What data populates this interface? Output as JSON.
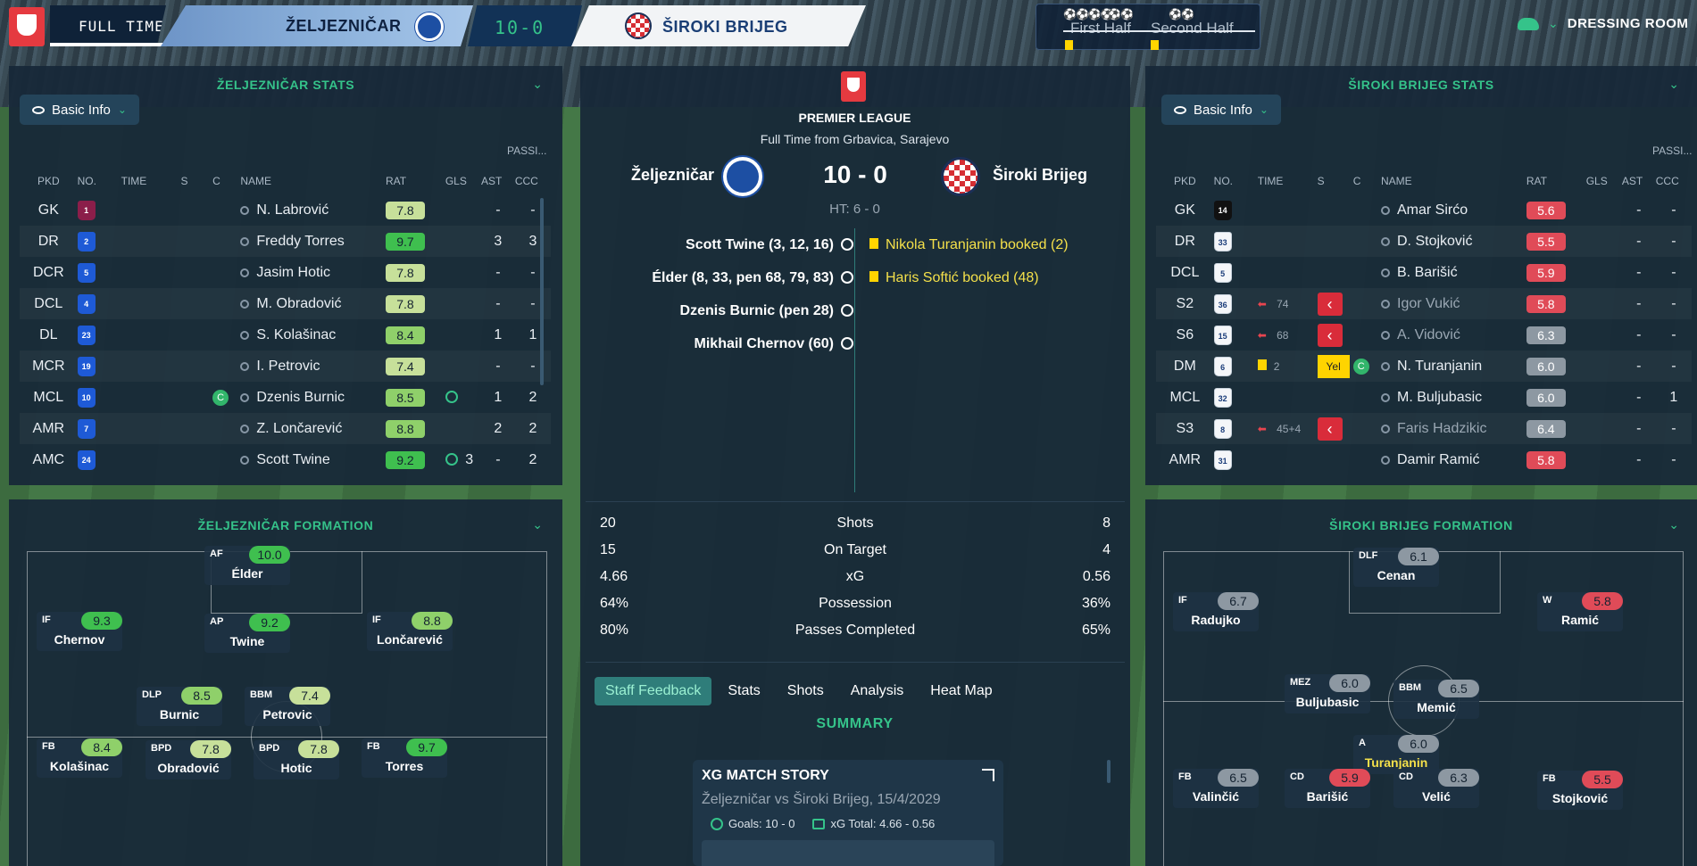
{
  "header": {
    "status": "FULL TIME",
    "home_team": "ŽELJEZNIČAR",
    "score": "10-0",
    "away_team": "ŠIROKI BRIJEG",
    "first_half": "First Half",
    "second_half": "Second Half",
    "home_goal_icons": "⚽⚽⚽⚽",
    "home_goal_icons_2": "⚽⚽",
    "away_goal_icons": "⚽⚽",
    "dressing_room": "DRESSING ROOM"
  },
  "left_stats": {
    "title": "ŽELJEZNIČAR STATS",
    "view": "Basic Info",
    "passing_label": "PASSI...",
    "columns": [
      "PKD",
      "NO.",
      "TIME",
      "S",
      "C",
      "NAME",
      "RAT",
      "GLS",
      "AST",
      "CCC"
    ],
    "rows": [
      {
        "pos": "GK",
        "no": "1",
        "name": "N. Labrović",
        "rat": "7.8",
        "gls": "",
        "ast": "-",
        "ccc": "-"
      },
      {
        "pos": "DR",
        "no": "2",
        "name": "Freddy Torres",
        "rat": "9.7",
        "gls": "",
        "ast": "3",
        "ccc": "3"
      },
      {
        "pos": "DCR",
        "no": "5",
        "name": "Jasim Hotic",
        "rat": "7.8",
        "gls": "",
        "ast": "-",
        "ccc": "-"
      },
      {
        "pos": "DCL",
        "no": "4",
        "name": "M. Obradović",
        "rat": "7.8",
        "gls": "",
        "ast": "-",
        "ccc": "-"
      },
      {
        "pos": "DL",
        "no": "23",
        "name": "S. Kolašinac",
        "rat": "8.4",
        "gls": "",
        "ast": "1",
        "ccc": "1"
      },
      {
        "pos": "MCR",
        "no": "19",
        "name": "I. Petrovic",
        "rat": "7.4",
        "gls": "",
        "ast": "-",
        "ccc": "-"
      },
      {
        "pos": "MCL",
        "no": "10",
        "name": "Dzenis Burnic",
        "rat": "8.5",
        "gls": "",
        "ast": "1",
        "ccc": "2"
      },
      {
        "pos": "AMR",
        "no": "7",
        "name": "Z. Lončarević",
        "rat": "8.8",
        "gls": "",
        "ast": "2",
        "ccc": "2"
      },
      {
        "pos": "AMC",
        "no": "24",
        "name": "Scott Twine",
        "rat": "9.2",
        "gls": "3",
        "ast": "-",
        "ccc": "2"
      }
    ]
  },
  "right_stats": {
    "title": "ŠIROKI BRIJEG STATS",
    "view": "Basic Info",
    "passing_label": "PASSI...",
    "columns": [
      "PKD",
      "NO.",
      "TIME",
      "S",
      "C",
      "NAME",
      "RAT",
      "GLS",
      "AST",
      "CCC"
    ],
    "rows": [
      {
        "pos": "GK",
        "no": "14",
        "time": "",
        "name": "Amar Sirćo",
        "rat": "5.6",
        "ast": "-",
        "ccc": "-"
      },
      {
        "pos": "DR",
        "no": "33",
        "time": "",
        "name": "D. Stojković",
        "rat": "5.5",
        "ast": "-",
        "ccc": "-"
      },
      {
        "pos": "DCL",
        "no": "5",
        "time": "",
        "name": "B. Barišić",
        "rat": "5.9",
        "ast": "-",
        "ccc": "-"
      },
      {
        "pos": "S2",
        "no": "36",
        "time": "74",
        "name": "Igor Vukić",
        "rat": "5.8",
        "ast": "-",
        "ccc": "-"
      },
      {
        "pos": "S6",
        "no": "15",
        "time": "68",
        "name": "A. Vidović",
        "rat": "6.3",
        "ast": "-",
        "ccc": "-"
      },
      {
        "pos": "DM",
        "no": "6",
        "time": "2",
        "name": "N. Turanjanin",
        "rat": "6.0",
        "ast": "-",
        "ccc": "-",
        "card": "Yel"
      },
      {
        "pos": "MCL",
        "no": "32",
        "time": "",
        "name": "M. Buljubasic",
        "rat": "6.0",
        "ast": "-",
        "ccc": "1"
      },
      {
        "pos": "S3",
        "no": "8",
        "time": "45+4",
        "name": "Faris Hadzikic",
        "rat": "6.4",
        "ast": "-",
        "ccc": "-"
      },
      {
        "pos": "AMR",
        "no": "31",
        "time": "",
        "name": "Damir Ramić",
        "rat": "5.8",
        "ast": "-",
        "ccc": "-"
      }
    ]
  },
  "match": {
    "competition": "PREMIER LEAGUE",
    "venue": "Full Time from Grbavica, Sarajevo",
    "home": "Željezničar",
    "away": "Široki Brijeg",
    "score": "10 - 0",
    "ht": "HT: 6 - 0",
    "home_events": [
      "Scott Twine (3, 12, 16)",
      "Élder (8, 33, pen 68, 79, 83)",
      "Dzenis Burnic (pen 28)",
      "Mikhail Chernov (60)"
    ],
    "away_events": [
      "Nikola Turanjanin booked (2)",
      "Haris Softić booked (48)"
    ],
    "stats": [
      {
        "home": "20",
        "label": "Shots",
        "away": "8"
      },
      {
        "home": "15",
        "label": "On Target",
        "away": "4"
      },
      {
        "home": "4.66",
        "label": "xG",
        "away": "0.56"
      },
      {
        "home": "64%",
        "label": "Possession",
        "away": "36%"
      },
      {
        "home": "80%",
        "label": "Passes Completed",
        "away": "65%"
      }
    ],
    "tabs": [
      "Staff Feedback",
      "Stats",
      "Shots",
      "Analysis",
      "Heat Map"
    ],
    "summary": "SUMMARY",
    "xg_card": {
      "title": "XG MATCH STORY",
      "subtitle": "Željezničar vs Široki Brijeg, 15/4/2029",
      "goals": "Goals: 10 - 0",
      "xg_total": "xG Total: 4.66 - 0.56"
    }
  },
  "left_formation": {
    "title": "ŽELJEZNIČAR FORMATION",
    "players": [
      {
        "role": "AF",
        "rating": "10.0",
        "name": "Élder"
      },
      {
        "role": "IF",
        "rating": "9.3",
        "name": "Chernov"
      },
      {
        "role": "AP",
        "rating": "9.2",
        "name": "Twine"
      },
      {
        "role": "IF",
        "rating": "8.8",
        "name": "Lončarević"
      },
      {
        "role": "DLP",
        "rating": "8.5",
        "name": "Burnic"
      },
      {
        "role": "BBM",
        "rating": "7.4",
        "name": "Petrovic"
      },
      {
        "role": "FB",
        "rating": "8.4",
        "name": "Kolašinac"
      },
      {
        "role": "BPD",
        "rating": "7.8",
        "name": "Obradović"
      },
      {
        "role": "BPD",
        "rating": "7.8",
        "name": "Hotic"
      },
      {
        "role": "FB",
        "rating": "9.7",
        "name": "Torres"
      }
    ]
  },
  "right_formation": {
    "title": "ŠIROKI BRIJEG FORMATION",
    "players": [
      {
        "role": "DLF",
        "rating": "6.1",
        "name": "Cenan"
      },
      {
        "role": "IF",
        "rating": "6.7",
        "name": "Radujko"
      },
      {
        "role": "W",
        "rating": "5.8",
        "name": "Ramić"
      },
      {
        "role": "MEZ",
        "rating": "6.0",
        "name": "Buljubasic"
      },
      {
        "role": "BBM",
        "rating": "6.5",
        "name": "Memić"
      },
      {
        "role": "A",
        "rating": "6.0",
        "name": "Turanjanin"
      },
      {
        "role": "FB",
        "rating": "6.5",
        "name": "Valinčić"
      },
      {
        "role": "CD",
        "rating": "5.9",
        "name": "Barišić"
      },
      {
        "role": "CD",
        "rating": "6.3",
        "name": "Velić"
      },
      {
        "role": "FB",
        "rating": "5.5",
        "name": "Stojković"
      }
    ]
  },
  "colors": {
    "accent": "#35c38a",
    "panel": "#172838",
    "rating_high": "#3fbf4f",
    "rating_low": "#e04b58",
    "booking": "#ffd400"
  }
}
